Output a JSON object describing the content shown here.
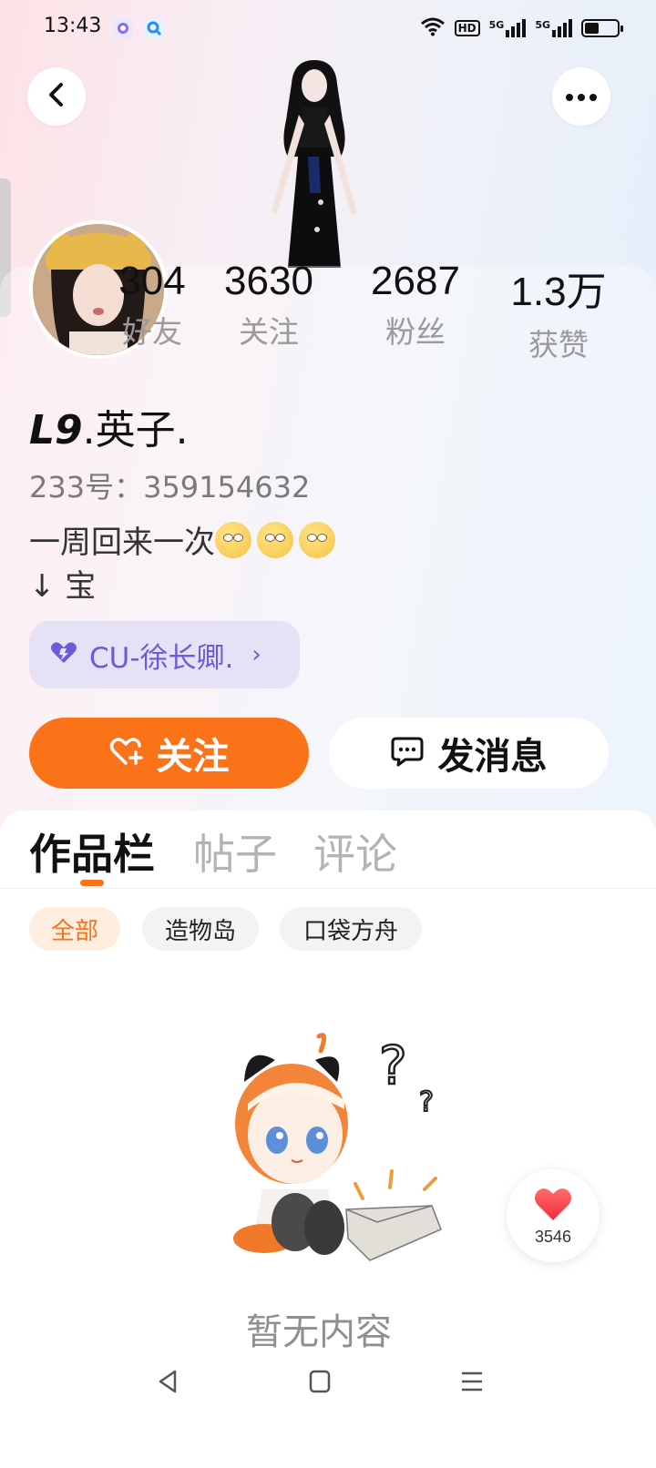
{
  "status_bar": {
    "time": "13:43",
    "hd_label": "HD",
    "signal_1": "5G",
    "signal_2": "5G",
    "battery_level": 0.45
  },
  "header": {
    "back_icon": "chevron-left-icon",
    "more_icon": "more-horizontal-icon"
  },
  "stats": [
    {
      "value": "304",
      "label": "好友"
    },
    {
      "value": "3630",
      "label": "关注"
    },
    {
      "value": "2687",
      "label": "粉丝"
    },
    {
      "value": "1.3万",
      "label": "获赞"
    }
  ],
  "profile": {
    "name_badge": "L9",
    "name_rest": ".英子.",
    "id_line": "233号：359154632",
    "bio_line1": "一周回来一次",
    "bio_line2": "↓ 宝",
    "team_label": "CU-徐长卿.",
    "team_chevron": "›"
  },
  "actions": {
    "follow_label": "关注",
    "message_label": "发消息"
  },
  "tabs": [
    {
      "label": "作品栏",
      "active": true
    },
    {
      "label": "帖子",
      "active": false
    },
    {
      "label": "评论",
      "active": false
    }
  ],
  "filters": [
    {
      "label": "全部",
      "active": true
    },
    {
      "label": "造物岛",
      "active": false
    },
    {
      "label": "口袋方舟",
      "active": false
    }
  ],
  "empty_state": {
    "text": "暂无内容"
  },
  "like_float": {
    "count": "3546"
  },
  "colors": {
    "accent": "#fb7318",
    "team_purple": "#6a5cd8",
    "team_bg": "#e5e2f6"
  }
}
